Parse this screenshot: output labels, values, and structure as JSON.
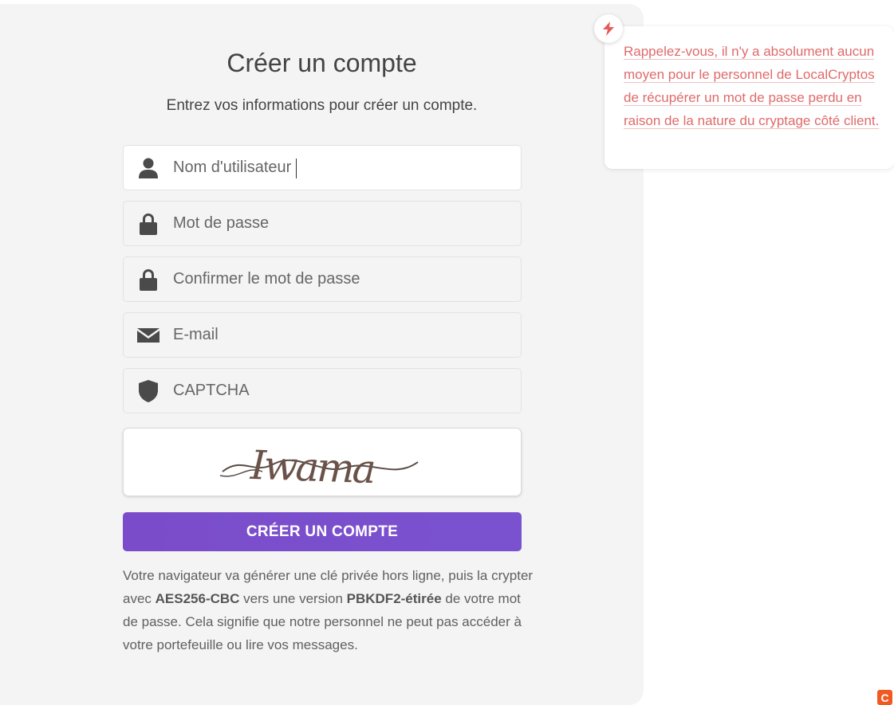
{
  "form": {
    "title": "Créer un compte",
    "subtitle": "Entrez vos informations pour créer un compte.",
    "fields": [
      {
        "placeholder": "Nom d'utilisateur",
        "icon": "user-icon",
        "value": ""
      },
      {
        "placeholder": "Mot de passe",
        "icon": "lock-icon",
        "value": ""
      },
      {
        "placeholder": "Confirmer le mot de passe",
        "icon": "lock-icon",
        "value": ""
      },
      {
        "placeholder": "E-mail",
        "icon": "envelope-icon",
        "value": ""
      },
      {
        "placeholder": "CAPTCHA",
        "icon": "shield-icon",
        "value": ""
      }
    ],
    "captcha_text": "Iwama",
    "submit_label": "CRÉER UN COMPTE",
    "info": {
      "part1": "Votre navigateur va générer une clé privée hors ligne, puis la crypter avec ",
      "algo": "AES256-CBC",
      "part2": " vers une version ",
      "kdf": "PBKDF2-étirée",
      "part3": " de votre mot de passe. Cela signifie que notre personnel ne peut pas accéder à votre portefeuille ou lire vos messages."
    }
  },
  "hint": {
    "icon": "lightning-icon",
    "text": "Rappelez-vous, il n'y a absolument aucun moyen pour le personnel de LocalCryptos de récupérer un mot de passe perdu en raison de la nature du cryptage côté client."
  },
  "corner_logo": {
    "glyph": "C",
    "icon": "brand-logo-icon"
  },
  "colors": {
    "accent": "#7b4cc9",
    "hint_text": "#e06a6a",
    "card_bg": "#f4f4f4"
  }
}
